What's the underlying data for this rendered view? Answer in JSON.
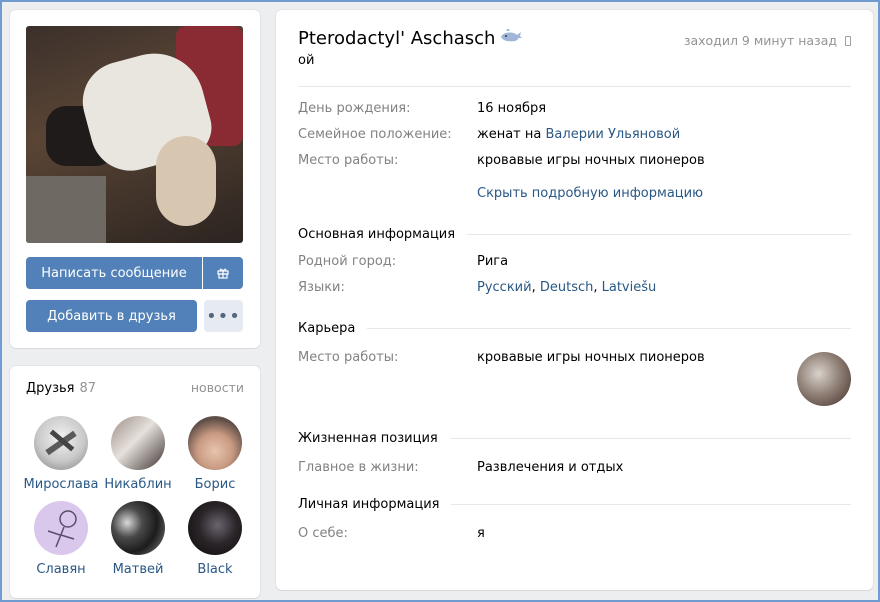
{
  "profile": {
    "name": "Pterodactyl' Aschasch",
    "status": "ой",
    "last_seen": "заходил 9 минут назад",
    "name_emoji": "whale-icon"
  },
  "actions": {
    "send_message": "Написать сообщение",
    "add_friend": "Добавить в друзья",
    "more": "•••"
  },
  "friends": {
    "title": "Друзья",
    "count": "87",
    "news_link": "новости",
    "items": [
      {
        "name": "Мирослава"
      },
      {
        "name": "Никаблин"
      },
      {
        "name": "Борис"
      },
      {
        "name": "Славян"
      },
      {
        "name": "Матвей"
      },
      {
        "name": "Black"
      }
    ]
  },
  "info": {
    "birthday_label": "День рождения:",
    "birthday_value": "16 ноября",
    "relationship_label": "Семейное положение:",
    "relationship_prefix": "женат на",
    "relationship_partner": "Валерии Ульяновой",
    "work_label": "Место работы:",
    "work_value": "кровавые игры ночных пионеров",
    "hide_details": "Скрыть подробную информацию"
  },
  "basic": {
    "title": "Основная информация",
    "hometown_label": "Родной город:",
    "hometown_value": "Рига",
    "languages_label": "Языки:",
    "languages": [
      "Русский",
      "Deutsch",
      "Latviešu"
    ]
  },
  "career": {
    "title": "Карьера",
    "work_label": "Место работы:",
    "work_value": "кровавые игры ночных пионеров"
  },
  "life": {
    "title": "Жизненная позиция",
    "main_label": "Главное в жизни:",
    "main_value": "Развлечения и отдых"
  },
  "personal": {
    "title": "Личная информация",
    "about_label": "О себе:",
    "about_value": "я"
  },
  "colors": {
    "accent": "#5181b8",
    "link": "#2a5885",
    "muted": "#828282",
    "background": "#edeef0"
  }
}
